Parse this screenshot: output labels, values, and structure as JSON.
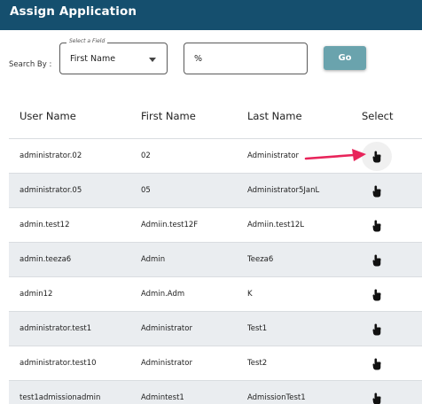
{
  "header": {
    "title": "Assign Application"
  },
  "search": {
    "label": "Search By :",
    "field_legend": "Select a Field",
    "field_value": "First Name",
    "query_value": "%",
    "go_label": "Go"
  },
  "table": {
    "columns": [
      "User Name",
      "First Name",
      "Last Name",
      "Select"
    ],
    "rows": [
      {
        "user": "administrator.02",
        "first": "02",
        "last": "Administrator"
      },
      {
        "user": "administrator.05",
        "first": "05",
        "last": "Administrator5JanL"
      },
      {
        "user": "admin.test12",
        "first": "Admiin.test12F",
        "last": "Admiin.test12L"
      },
      {
        "user": "admin.teeza6",
        "first": "Admin",
        "last": "Teeza6"
      },
      {
        "user": "admin12",
        "first": "Admin.Adm",
        "last": "K"
      },
      {
        "user": "administrator.test1",
        "first": "Administrator",
        "last": "Test1"
      },
      {
        "user": "administrator.test10",
        "first": "Administrator",
        "last": "Test2"
      },
      {
        "user": "test1admissionadmin",
        "first": "Admintest1",
        "last": "AdmissionTest1"
      }
    ]
  },
  "colors": {
    "header_bg": "#154f6e",
    "go_button": "#6aa3ad",
    "alt_row": "#eaedf0",
    "annotation_arrow": "#e8245a"
  },
  "icons": {
    "select": "hand-pointer-icon",
    "annotation": "arrow-right-icon",
    "dropdown": "caret-down-icon"
  }
}
